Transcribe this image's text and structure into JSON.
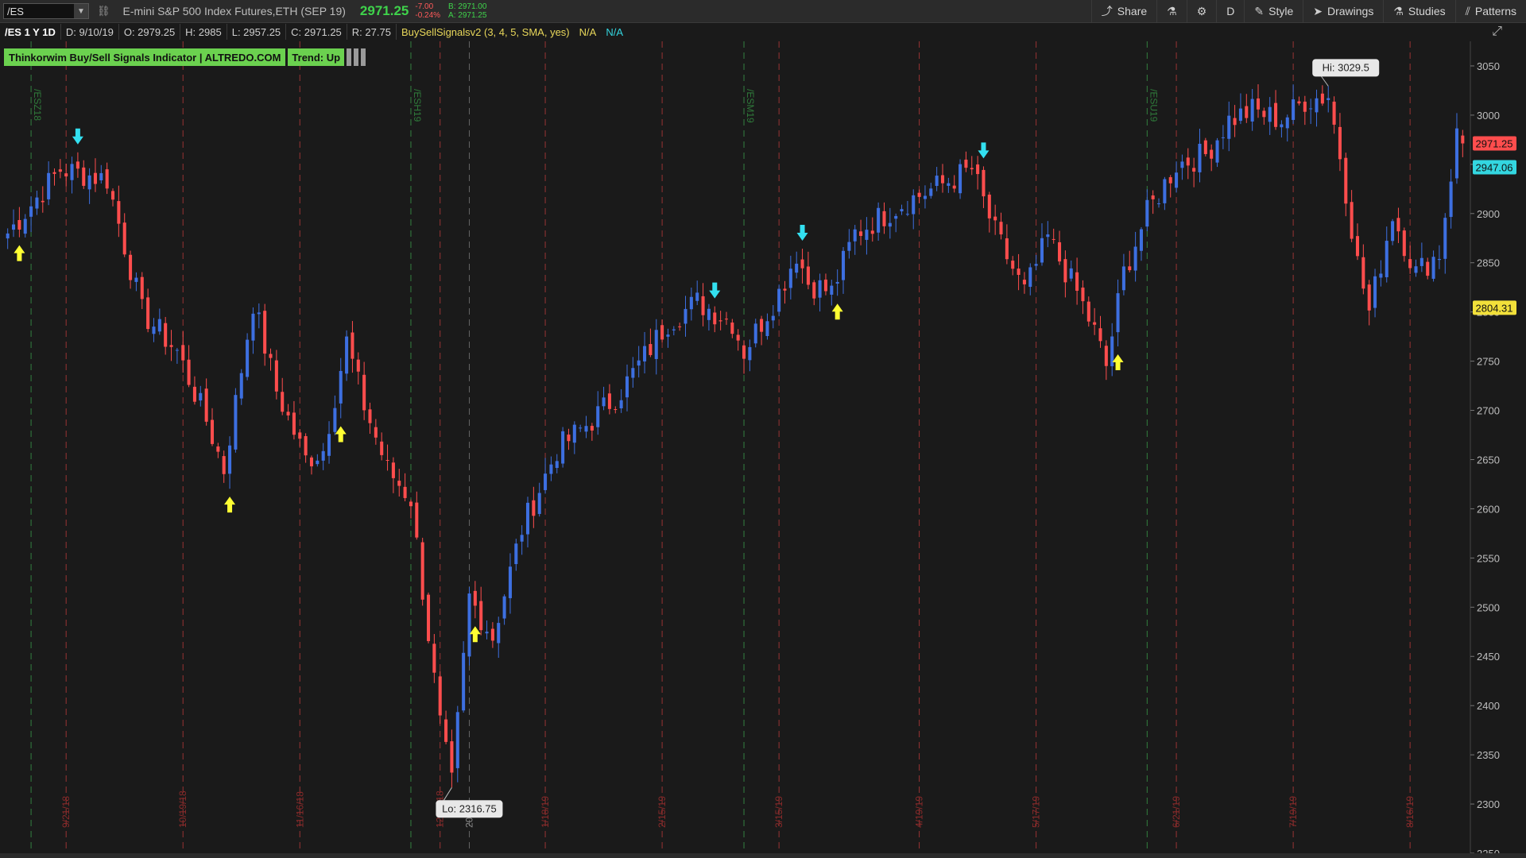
{
  "topbar": {
    "symbol": "/ES",
    "description": "E-mini S&P 500 Index Futures,ETH (SEP 19)",
    "last_price": "2971.25",
    "change": "-7.00",
    "change_pct": "-0.24%",
    "bid": "B: 2971.00",
    "ask": "A: 2971.25",
    "buttons": [
      {
        "label": "Share",
        "icon": "share-icon"
      },
      {
        "label": "",
        "icon": "flask-icon"
      },
      {
        "label": "",
        "icon": "gear-icon"
      },
      {
        "label": "D",
        "icon": ""
      },
      {
        "label": "Style",
        "icon": "style-icon"
      },
      {
        "label": "Drawings",
        "icon": "cursor-icon"
      },
      {
        "label": "Studies",
        "icon": "flask-icon"
      },
      {
        "label": "Patterns",
        "icon": "patterns-icon"
      }
    ]
  },
  "infobar": {
    "symbol_period": "/ES 1 Y 1D",
    "date": "D: 9/10/19",
    "open": "O: 2979.25",
    "high": "H: 2985",
    "low": "L: 2957.25",
    "close": "C: 2971.25",
    "range": "R: 27.75",
    "study": "BuySellSignalsv2 (3, 4, 5, SMA, yes)",
    "na1": "N/A",
    "na2": "N/A"
  },
  "indicator": {
    "title": "Thinkorwim Buy/Sell Signals Indicator | ALTREDO.COM",
    "trend": "Trend: Up"
  },
  "colors": {
    "up": "#3d6fe0",
    "down": "#ff4d4d",
    "buy_arrow": "#ffff33",
    "sell_arrow": "#33e0f0",
    "month_line": "#b83a3a",
    "contract_line": "#3a9a4a"
  },
  "chart_data": {
    "type": "candlestick",
    "ylim": [
      2250,
      3075
    ],
    "y_ticks": [
      2250,
      2300,
      2350,
      2400,
      2450,
      2500,
      2550,
      2600,
      2650,
      2700,
      2750,
      2800,
      2850,
      2900,
      2950,
      3000,
      3050
    ],
    "n_bars": 250,
    "month_labels": [
      {
        "label": "9/21/18",
        "bar": 10
      },
      {
        "label": "10/19/18",
        "bar": 30
      },
      {
        "label": "11/16/18",
        "bar": 50
      },
      {
        "label": "12/21/18",
        "bar": 74
      },
      {
        "label": "2019",
        "bar": 79
      },
      {
        "label": "1/18/19",
        "bar": 92
      },
      {
        "label": "2/15/19",
        "bar": 112
      },
      {
        "label": "3/15/19",
        "bar": 132
      },
      {
        "label": "4/19/19",
        "bar": 156
      },
      {
        "label": "5/17/19",
        "bar": 176
      },
      {
        "label": "6/21/19",
        "bar": 200
      },
      {
        "label": "7/19/19",
        "bar": 220
      },
      {
        "label": "8/16/19",
        "bar": 240
      }
    ],
    "contract_labels": [
      {
        "label": "/ESZ18",
        "bar": 4
      },
      {
        "label": "/ESH19",
        "bar": 69
      },
      {
        "label": "/ESM19",
        "bar": 126
      },
      {
        "label": "/ESU19",
        "bar": 195
      }
    ],
    "anchors": [
      [
        0,
        2880
      ],
      [
        9,
        2945
      ],
      [
        17,
        2935
      ],
      [
        23,
        2800
      ],
      [
        29,
        2760
      ],
      [
        34,
        2690
      ],
      [
        37,
        2640
      ],
      [
        42,
        2810
      ],
      [
        46,
        2720
      ],
      [
        51,
        2650
      ],
      [
        54,
        2660
      ],
      [
        58,
        2770
      ],
      [
        61,
        2705
      ],
      [
        65,
        2640
      ],
      [
        69,
        2610
      ],
      [
        74,
        2380
      ],
      [
        76,
        2320
      ],
      [
        79,
        2510
      ],
      [
        83,
        2470
      ],
      [
        88,
        2580
      ],
      [
        94,
        2660
      ],
      [
        100,
        2690
      ],
      [
        105,
        2720
      ],
      [
        113,
        2790
      ],
      [
        118,
        2810
      ],
      [
        124,
        2790
      ],
      [
        126,
        2760
      ],
      [
        132,
        2820
      ],
      [
        135,
        2860
      ],
      [
        137,
        2830
      ],
      [
        141,
        2820
      ],
      [
        145,
        2880
      ],
      [
        153,
        2910
      ],
      [
        160,
        2930
      ],
      [
        165,
        2945
      ],
      [
        169,
        2880
      ],
      [
        174,
        2820
      ],
      [
        178,
        2875
      ],
      [
        183,
        2820
      ],
      [
        186,
        2780
      ],
      [
        188,
        2745
      ],
      [
        191,
        2840
      ],
      [
        195,
        2900
      ],
      [
        200,
        2950
      ],
      [
        205,
        2960
      ],
      [
        209,
        2995
      ],
      [
        213,
        3005
      ],
      [
        218,
        2995
      ],
      [
        222,
        3015
      ],
      [
        226,
        3020
      ],
      [
        228,
        2960
      ],
      [
        231,
        2850
      ],
      [
        233,
        2800
      ],
      [
        237,
        2900
      ],
      [
        241,
        2840
      ],
      [
        245,
        2860
      ],
      [
        248,
        2980
      ],
      [
        249,
        2971
      ]
    ],
    "last_bar": {
      "open": 2979.25,
      "high": 2985,
      "low": 2957.25,
      "close": 2971.25
    },
    "buy_signals": [
      2,
      38,
      57,
      80,
      142,
      190
    ],
    "sell_signals": [
      12,
      121,
      136,
      167
    ],
    "high_marker": {
      "label": "Hi: 3029.5",
      "value": 3029.5,
      "bar": 226
    },
    "low_marker": {
      "label": "Lo: 2316.75",
      "value": 2316.75,
      "bar": 76
    },
    "price_tags": [
      {
        "label": "2971.25",
        "value": 2971.25,
        "color": "#ff4d4d"
      },
      {
        "label": "2947.06",
        "value": 2947.06,
        "color": "#33d6e0"
      },
      {
        "label": "2804.31",
        "value": 2804.31,
        "color": "#f2e03a"
      }
    ]
  }
}
